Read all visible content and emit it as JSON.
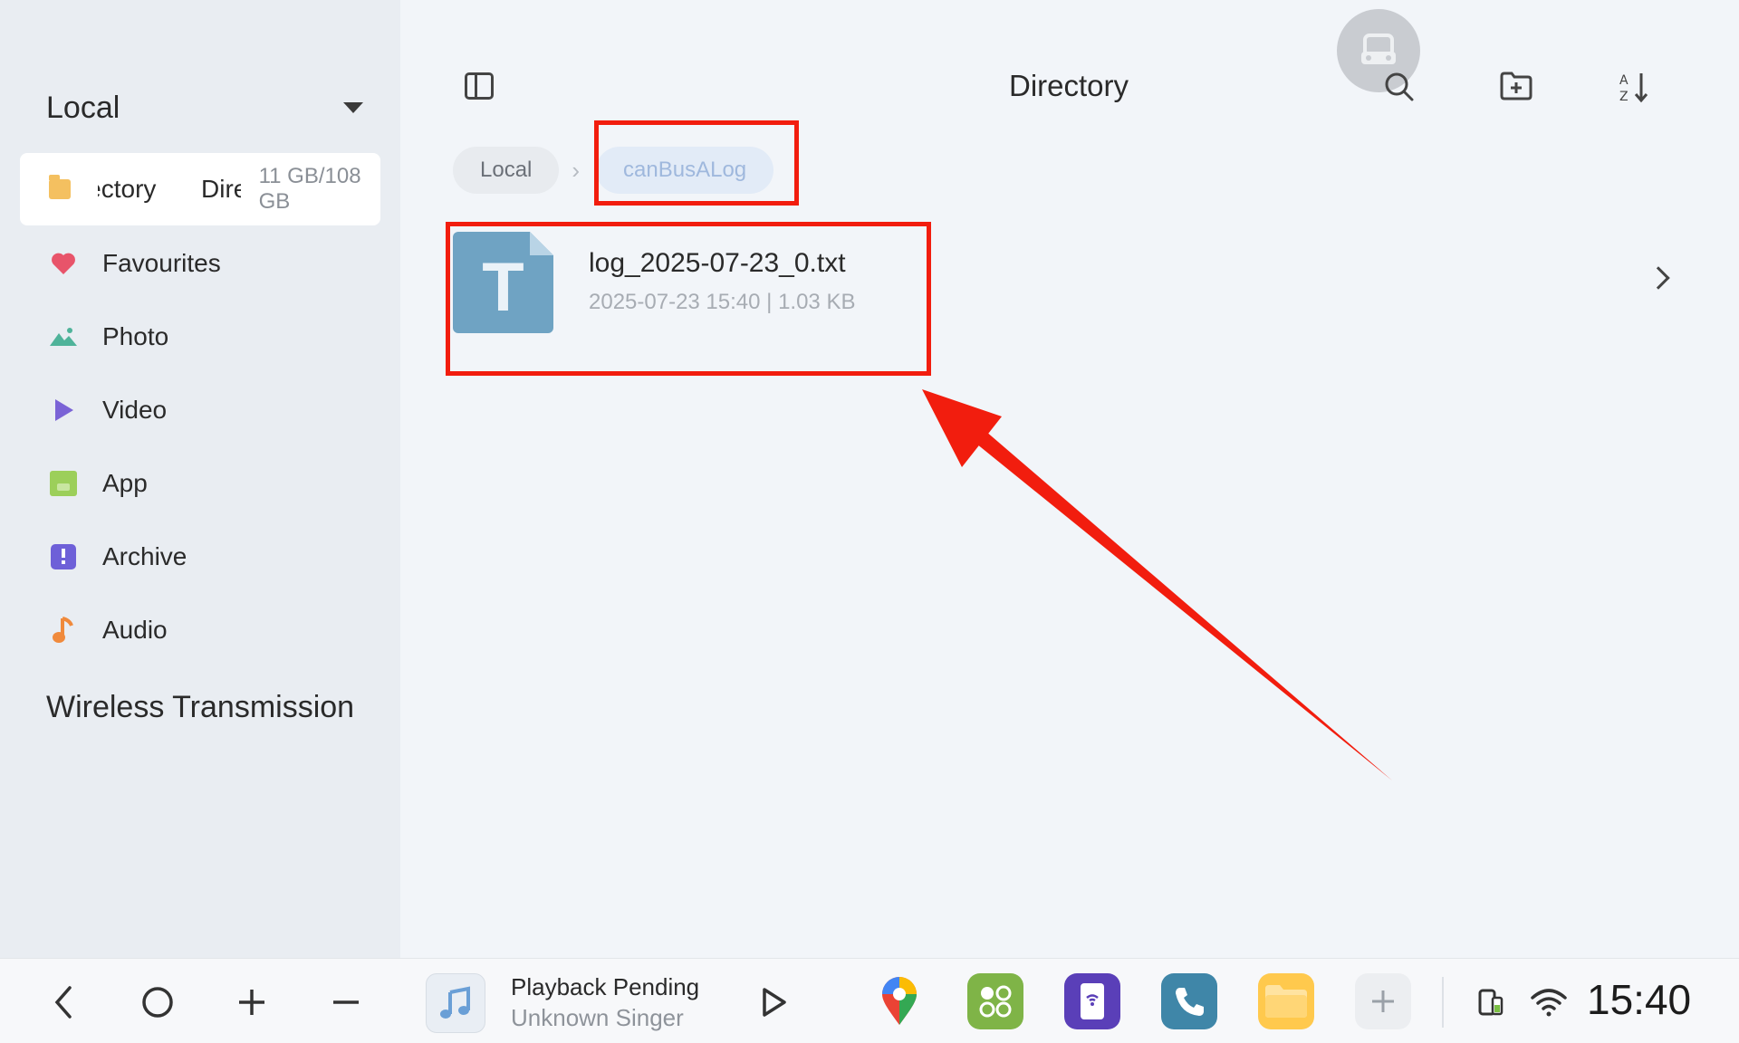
{
  "sidebar": {
    "header_title": "Local",
    "storage": {
      "name_part1": "Directory",
      "name_part2": "Directory",
      "size": "11 GB/108 GB"
    },
    "items": [
      {
        "label": "Favourites",
        "icon": "heart-icon"
      },
      {
        "label": "Photo",
        "icon": "photo-icon"
      },
      {
        "label": "Video",
        "icon": "video-icon"
      },
      {
        "label": "App",
        "icon": "app-icon"
      },
      {
        "label": "Archive",
        "icon": "archive-icon"
      },
      {
        "label": "Audio",
        "icon": "audio-icon"
      }
    ],
    "section_title": "Wireless Transmission"
  },
  "header": {
    "title": "Directory"
  },
  "breadcrumb": {
    "root": "Local",
    "current": "canBusALog"
  },
  "files": [
    {
      "name": "log_2025-07-23_0.txt",
      "meta": "2025-07-23 15:40 | 1.03 KB",
      "icon_letter": "T"
    }
  ],
  "taskbar": {
    "music_title": "Playback Pending",
    "music_artist": "Unknown Singer",
    "clock": "15:40"
  },
  "colors": {
    "highlight": "#f21d0e",
    "accent": "#6fa3c3"
  }
}
